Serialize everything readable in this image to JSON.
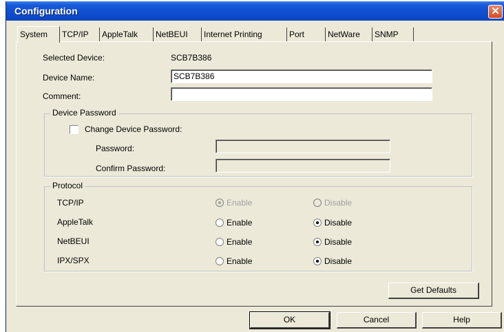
{
  "window": {
    "title": "Configuration",
    "close_glyph": "✕"
  },
  "tabs": [
    {
      "label": "System",
      "active": true
    },
    {
      "label": "TCP/IP"
    },
    {
      "label": "AppleTalk"
    },
    {
      "label": "NetBEUI"
    },
    {
      "label": "Internet Printing"
    },
    {
      "label": "Port"
    },
    {
      "label": "NetWare"
    },
    {
      "label": "SNMP"
    }
  ],
  "system": {
    "selected_device_label": "Selected Device:",
    "selected_device_value": "SCB7B386",
    "device_name_label": "Device Name:",
    "device_name_value": "SCB7B386",
    "comment_label": "Comment:",
    "comment_value": ""
  },
  "password_group": {
    "title": "Device Password",
    "change_label": "Change Device Password:",
    "change_checked": false,
    "password_label": "Password:",
    "password_value": "",
    "confirm_label": "Confirm Password:",
    "confirm_value": ""
  },
  "protocol_group": {
    "title": "Protocol",
    "enable_label": "Enable",
    "disable_label": "Disable",
    "rows": [
      {
        "name": "TCP/IP",
        "selected": "enable",
        "disabled": true
      },
      {
        "name": "AppleTalk",
        "selected": "disable",
        "disabled": false
      },
      {
        "name": "NetBEUI",
        "selected": "disable",
        "disabled": false
      },
      {
        "name": "IPX/SPX",
        "selected": "disable",
        "disabled": false
      }
    ]
  },
  "buttons": {
    "get_defaults": "Get Defaults",
    "ok": "OK",
    "cancel": "Cancel",
    "help": "Help"
  },
  "colors": {
    "titlebar": "#0f4fd0",
    "close_button": "#d64a1e",
    "dialog_face": "#ece9d8"
  },
  "icons": {
    "close": "close-icon"
  }
}
